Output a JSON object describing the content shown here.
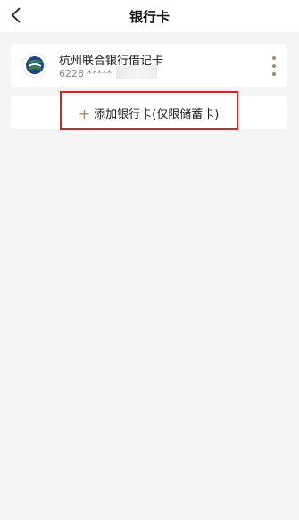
{
  "header": {
    "title": "银行卡"
  },
  "card": {
    "bank_name": "杭州联合银行借记卡",
    "card_number": "6228 *****"
  },
  "add_card": {
    "label": "添加银行卡(仅限储蓄卡)",
    "plus": "+"
  },
  "colors": {
    "accent": "#a88a5c",
    "highlight": "#e02020",
    "bank_logo_green": "#2e8b3a",
    "bank_logo_blue": "#1f3f8f"
  },
  "icons": {
    "back": "chevron-left-icon",
    "more": "more-vertical-icon",
    "logo": "bank-logo-icon"
  }
}
